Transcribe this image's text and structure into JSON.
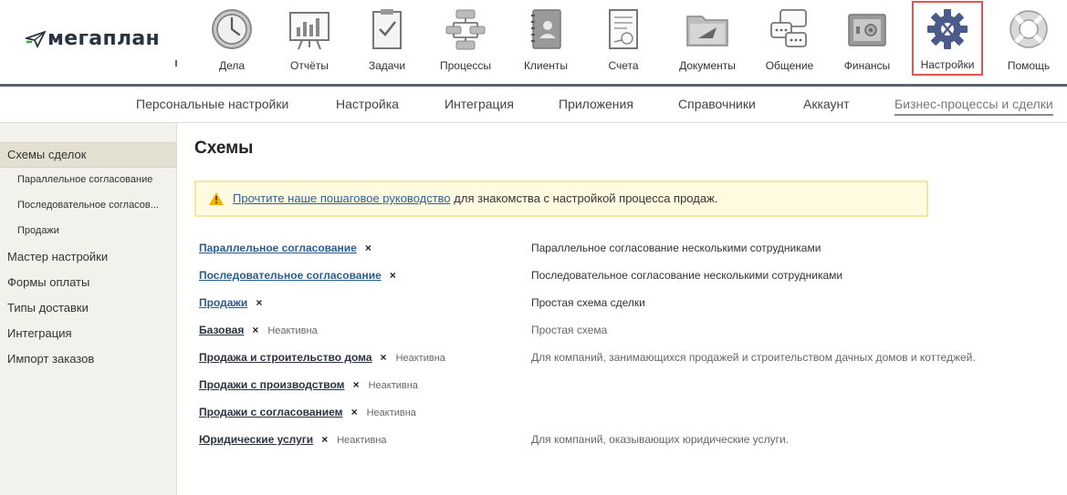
{
  "brand": {
    "logo_text": "мегаплан"
  },
  "nav": [
    {
      "label": "Дела",
      "icon": "clock-icon"
    },
    {
      "label": "Отчёты",
      "icon": "report-board-icon"
    },
    {
      "label": "Задачи",
      "icon": "clipboard-check-icon"
    },
    {
      "label": "Процессы",
      "icon": "process-flow-icon"
    },
    {
      "label": "Клиенты",
      "icon": "contacts-book-icon"
    },
    {
      "label": "Счета",
      "icon": "invoice-icon"
    },
    {
      "label": "Документы",
      "icon": "folder-icon"
    },
    {
      "label": "Общение",
      "icon": "chat-bubbles-icon"
    },
    {
      "label": "Финансы",
      "icon": "safe-icon"
    },
    {
      "label": "Настройки",
      "icon": "gear-icon",
      "active": true
    },
    {
      "label": "Помощь",
      "icon": "lifebuoy-icon"
    }
  ],
  "subnav": [
    "Персональные настройки",
    "Настройка",
    "Интеграция",
    "Приложения",
    "Справочники",
    "Аккаунт",
    "Бизнес-процессы и сделки"
  ],
  "sidebar": [
    {
      "label": "Схемы сделок",
      "level": 0,
      "active": true
    },
    {
      "label": "Параллельное согласование",
      "level": 1
    },
    {
      "label": "Последовательное согласов...",
      "level": 1
    },
    {
      "label": "Продажи",
      "level": 1
    },
    {
      "label": "Мастер настройки",
      "level": 0
    },
    {
      "label": "Формы оплаты",
      "level": 0
    },
    {
      "label": "Типы доставки",
      "level": 0
    },
    {
      "label": "Интеграция",
      "level": 0
    },
    {
      "label": "Импорт заказов",
      "level": 0
    }
  ],
  "main": {
    "title": "Схемы",
    "notice": {
      "link": "Прочтите наше пошаговое руководство",
      "text": " для знакомства с настройкой процесса продаж."
    },
    "delete_symbol": "×",
    "inactive_label": "Неактивна",
    "schemes": [
      {
        "name": "Параллельное согласование",
        "inactive": false,
        "desc": "Параллельное согласование несколькими сотрудниками"
      },
      {
        "name": "Последовательное согласование",
        "inactive": false,
        "desc": "Последовательное согласование несколькими сотрудниками"
      },
      {
        "name": "Продажи",
        "inactive": false,
        "desc": "Простая схема сделки"
      },
      {
        "name": "Базовая",
        "inactive": true,
        "desc": "Простая схема"
      },
      {
        "name": "Продажа и строительство дома",
        "inactive": true,
        "desc": "Для компаний, занимающихся продажей и строительством дачных домов и коттеджей."
      },
      {
        "name": "Продажи с производством",
        "inactive": true,
        "desc": ""
      },
      {
        "name": "Продажи с согласованием",
        "inactive": true,
        "desc": ""
      },
      {
        "name": "Юридические услуги",
        "inactive": true,
        "desc": "Для компаний, оказывающих юридические услуги."
      }
    ]
  },
  "colors": {
    "accent_red": "#e25555",
    "link_blue": "#2a6496",
    "gear": "#4a5a8a"
  }
}
